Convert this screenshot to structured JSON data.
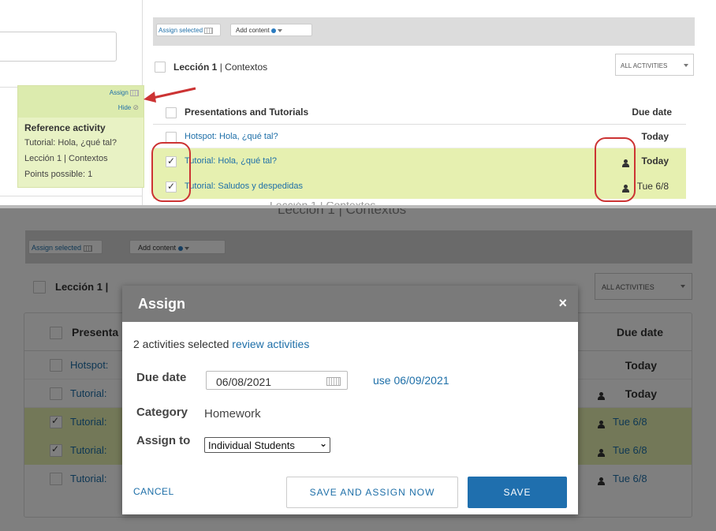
{
  "top": {
    "toolbar": {
      "assign_selected": "Assign selected",
      "add_content": "Add content"
    },
    "lesson": {
      "title": "Lección 1",
      "separator": " | ",
      "subtitle": "Contextos"
    },
    "filter": "ALL ACTIVITIES",
    "popover": {
      "assign": "Assign",
      "hide": "Hide",
      "heading": "Reference activity",
      "lines": [
        "Tutorial: Hola, ¿qué tal?",
        "Lección 1 | Contextos",
        "Points possible: 1"
      ]
    },
    "table": {
      "header": "Presentations and Tutorials",
      "due_header": "Due date",
      "rows": [
        {
          "name": "Hotspot: Hola, ¿qué tal?",
          "due": "Today"
        },
        {
          "name": "Tutorial: Hola, ¿qué tal?",
          "due": "Today"
        },
        {
          "name": "Tutorial: Saludos y despedidas",
          "due": "Tue 6/8"
        }
      ]
    }
  },
  "bottom": {
    "toolbar": {
      "assign_selected": "Assign selected",
      "add_content": "Add content"
    },
    "bg_title": "Lección 1 | Contextos",
    "lesson_label": "Lección 1 |",
    "filter": "ALL ACTIVITIES",
    "table": {
      "header": "Presenta",
      "due_header": "Due date",
      "rows": [
        {
          "name": "Hotspot:",
          "due": "Today"
        },
        {
          "name": "Tutorial:",
          "due": "Today"
        },
        {
          "name": "Tutorial:",
          "due": "Tue 6/8"
        },
        {
          "name": "Tutorial:",
          "due": "Tue 6/8"
        },
        {
          "name": "Tutorial:",
          "due": "Tue 6/8"
        }
      ]
    },
    "modal": {
      "title": "Assign",
      "close": "×",
      "selected_text": "2 activities selected",
      "review_link": "review activities",
      "due_label": "Due date",
      "due_value": "06/08/2021",
      "use_date": "use 06/09/2021",
      "category_label": "Category",
      "category_value": "Homework",
      "assign_to_label": "Assign to",
      "assign_to_value": "Individual Students",
      "cancel": "CANCEL",
      "save_assign": "SAVE AND ASSIGN NOW",
      "save": "SAVE"
    }
  },
  "colors": {
    "highlight": "#e6f0b0",
    "popover": "#e8f2c4",
    "link": "#1e6fa8",
    "modal_header": "#7a7a7a",
    "overlay": "rgba(0,0,0,0.5)",
    "save_button": "#1f6fae",
    "annotation_red": "#cc3333"
  }
}
